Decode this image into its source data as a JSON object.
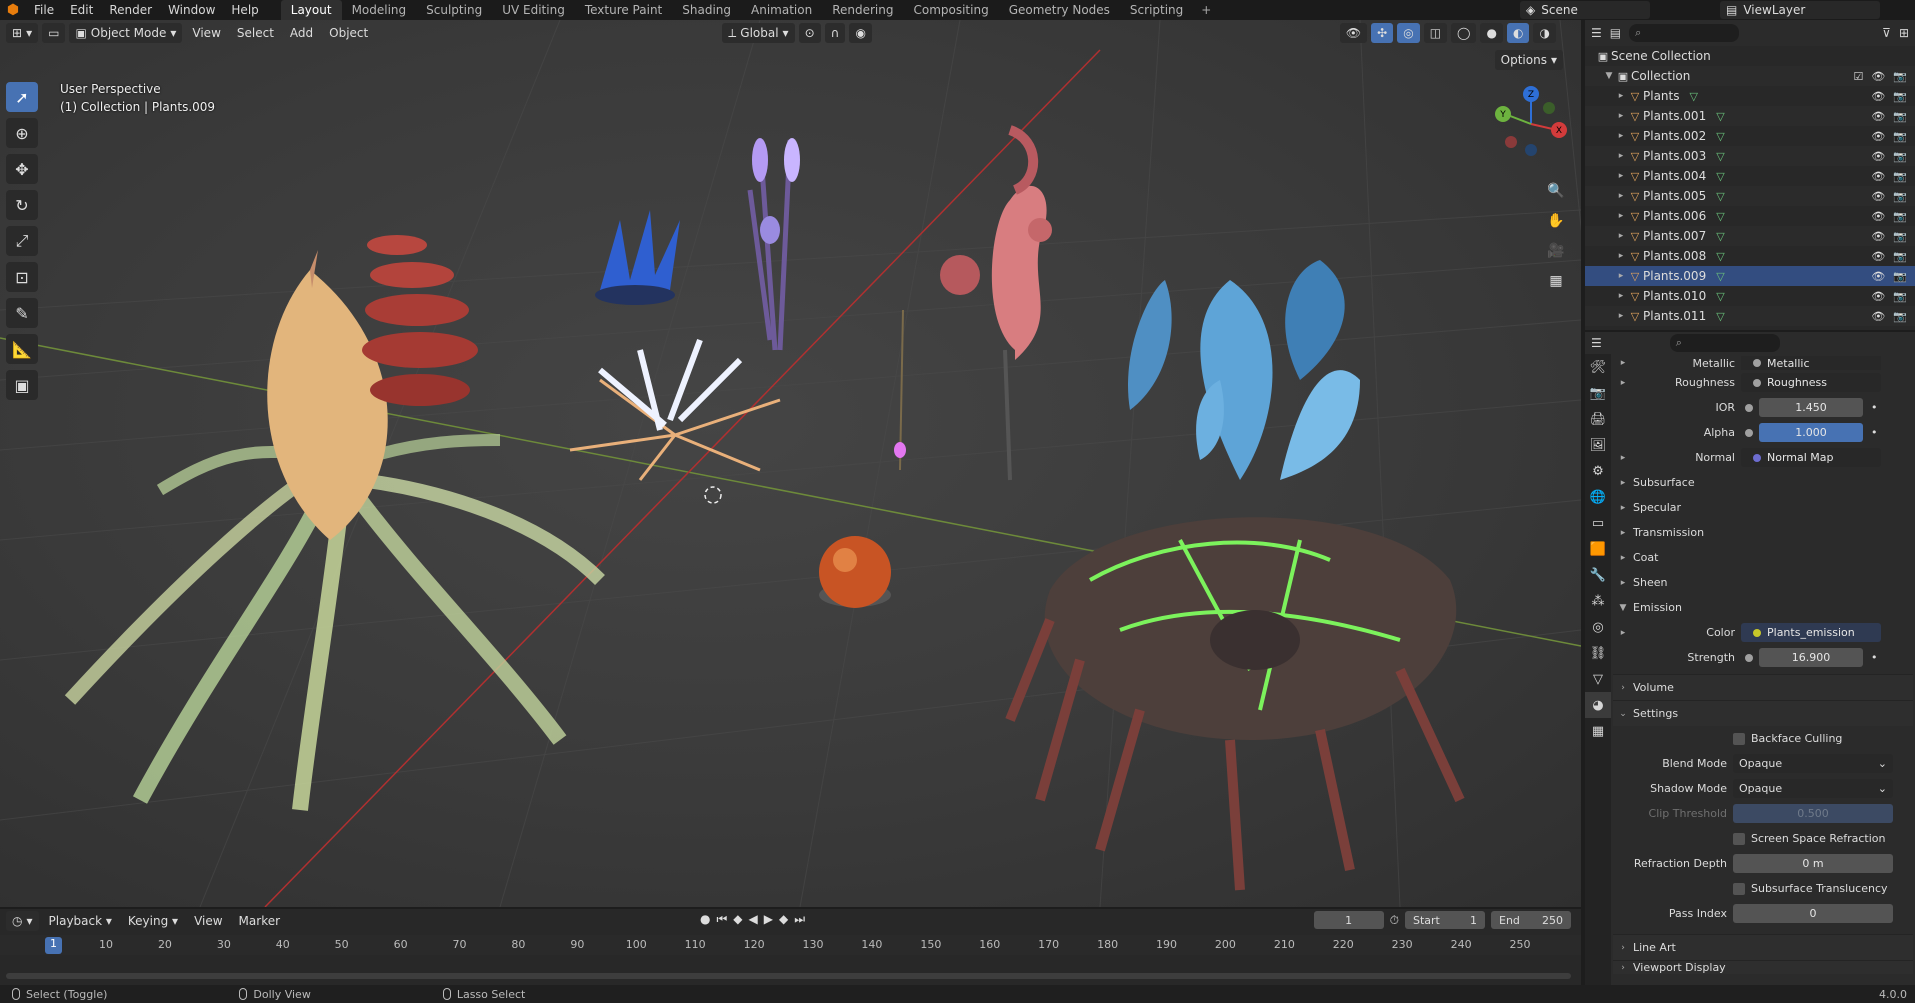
{
  "topbar": {
    "menus": [
      "File",
      "Edit",
      "Render",
      "Window",
      "Help"
    ],
    "workspaces": [
      "Layout",
      "Modeling",
      "Sculpting",
      "UV Editing",
      "Texture Paint",
      "Shading",
      "Animation",
      "Rendering",
      "Compositing",
      "Geometry Nodes",
      "Scripting"
    ],
    "active_workspace": "Layout",
    "scene": "Scene",
    "view_layer": "ViewLayer"
  },
  "viewport": {
    "mode": "Object Mode",
    "menus": [
      "View",
      "Select",
      "Add",
      "Object"
    ],
    "transform_orientation": "Global",
    "options_label": "Options",
    "perspective_label": "User Perspective",
    "context_label": "(1) Collection | Plants.009",
    "gizmo_axes": {
      "x": "X",
      "y": "Y",
      "z": "Z"
    }
  },
  "outliner": {
    "root": "Scene Collection",
    "collection": "Collection",
    "objects": [
      "Plants",
      "Plants.001",
      "Plants.002",
      "Plants.003",
      "Plants.004",
      "Plants.005",
      "Plants.006",
      "Plants.007",
      "Plants.008",
      "Plants.009",
      "Plants.010",
      "Plants.011"
    ],
    "selected": "Plants.009"
  },
  "properties": {
    "partial_row": {
      "label": "Metallic",
      "value": "Metallic"
    },
    "roughness": {
      "label": "Roughness",
      "value": "Roughness"
    },
    "ior": {
      "label": "IOR",
      "value": "1.450"
    },
    "alpha": {
      "label": "Alpha",
      "value": "1.000"
    },
    "normal": {
      "label": "Normal",
      "value": "Normal Map"
    },
    "subpanels": [
      "Subsurface",
      "Specular",
      "Transmission",
      "Coat",
      "Sheen"
    ],
    "emission": {
      "label": "Emission",
      "color_label": "Color",
      "color_value": "Plants_emission",
      "strength_label": "Strength",
      "strength_value": "16.900"
    },
    "volume_label": "Volume",
    "settings": {
      "label": "Settings",
      "backface_culling": "Backface Culling",
      "blend_mode_label": "Blend Mode",
      "blend_mode": "Opaque",
      "shadow_mode_label": "Shadow Mode",
      "shadow_mode": "Opaque",
      "clip_threshold_label": "Clip Threshold",
      "clip_threshold": "0.500",
      "screen_space_refraction": "Screen Space Refraction",
      "refraction_depth_label": "Refraction Depth",
      "refraction_depth": "0 m",
      "subsurface_translucency": "Subsurface Translucency",
      "pass_index_label": "Pass Index",
      "pass_index": "0"
    },
    "line_art_label": "Line Art",
    "viewport_display_label": "Viewport Display"
  },
  "timeline": {
    "menus": [
      "Playback",
      "Keying",
      "View",
      "Marker"
    ],
    "current_frame": "1",
    "start_label": "Start",
    "start": "1",
    "end_label": "End",
    "end": "250",
    "ticks": [
      "1",
      "10",
      "20",
      "30",
      "40",
      "50",
      "60",
      "70",
      "80",
      "90",
      "100",
      "110",
      "120",
      "130",
      "140",
      "150",
      "160",
      "170",
      "180",
      "190",
      "200",
      "210",
      "220",
      "230",
      "240",
      "250"
    ]
  },
  "statusbar": {
    "items": [
      "Select (Toggle)",
      "Dolly View",
      "Lasso Select"
    ],
    "version": "4.0.0"
  },
  "colors": {
    "accent": "#4772b3",
    "selected_row": "#334d80",
    "mesh_icon": "#6ac37c",
    "object_icon": "#e3a45c"
  }
}
